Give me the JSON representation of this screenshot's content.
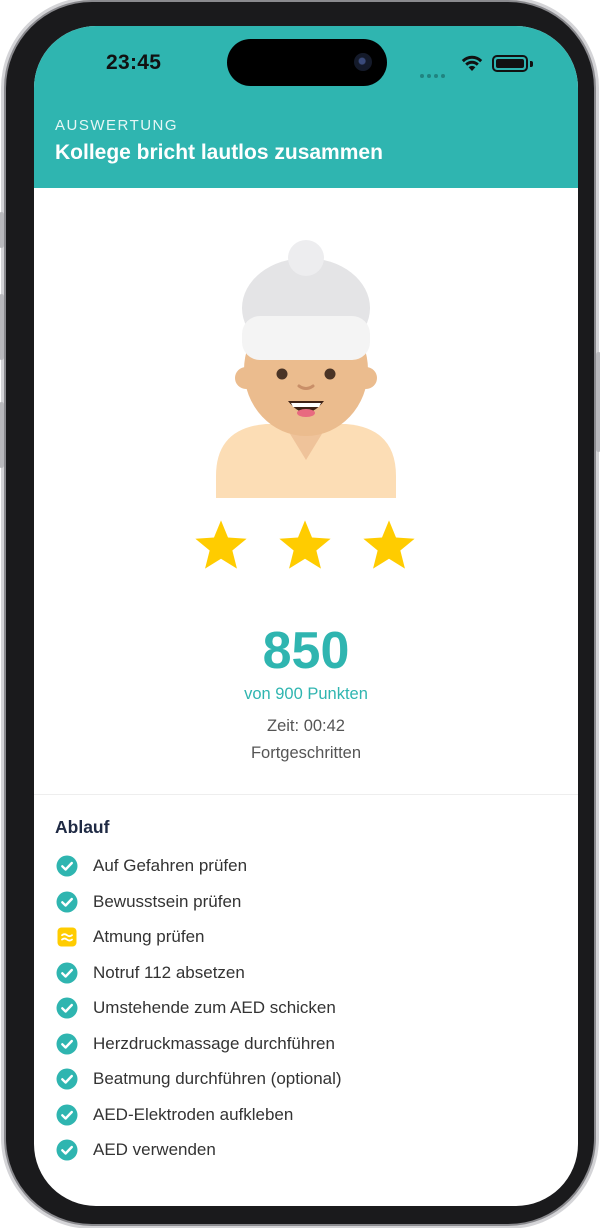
{
  "status_bar": {
    "time": "23:45"
  },
  "header": {
    "eyebrow": "AUSWERTUNG",
    "title": "Kollege bricht lautlos zusammen"
  },
  "avatar": {
    "icon": "person-beanie-avatar"
  },
  "rating": {
    "stars": 3,
    "max": 3,
    "color": "#FFCC00"
  },
  "result": {
    "score": "850",
    "max_text": "von 900 Punkten",
    "time": "Zeit: 00:42",
    "level": "Fortgeschritten"
  },
  "sequence": {
    "title": "Ablauf",
    "steps": [
      {
        "label": "Auf Gefahren prüfen",
        "status": "done"
      },
      {
        "label": "Bewusstsein prüfen",
        "status": "done"
      },
      {
        "label": "Atmung prüfen",
        "status": "partial"
      },
      {
        "label": "Notruf 112 absetzen",
        "status": "done"
      },
      {
        "label": "Umstehende zum AED schicken",
        "status": "done"
      },
      {
        "label": "Herzdruckmassage durchführen",
        "status": "done"
      },
      {
        "label": "Beatmung durchführen (optional)",
        "status": "done"
      },
      {
        "label": "AED-Elektroden aufkleben",
        "status": "done"
      },
      {
        "label": "AED verwenden",
        "status": "done"
      }
    ]
  },
  "colors": {
    "accent": "#2FB5B0",
    "done": "#2FB5B0",
    "partial": "#FFCC00"
  }
}
